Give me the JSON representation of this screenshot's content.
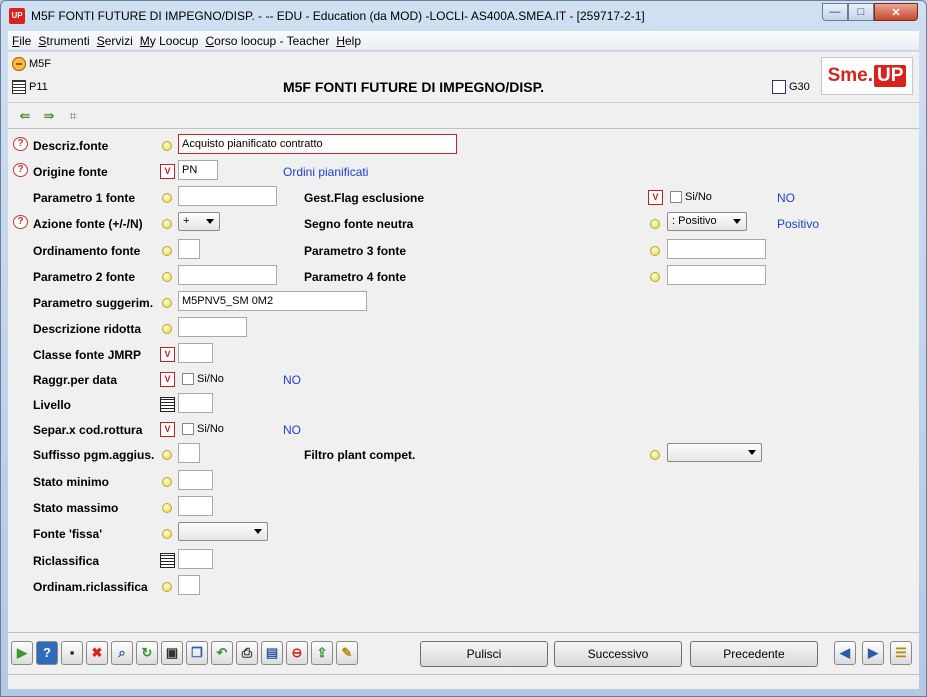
{
  "window": {
    "title": "M5F FONTI FUTURE DI IMPEGNO/DISP. -  -- EDU - Education (da MOD) -LOCLI- AS400A.SMEA.IT - [259717-2-1]",
    "app_icon": "UP",
    "controls": {
      "minimize": "—",
      "maximize": "□",
      "close": "✕"
    }
  },
  "menu": [
    "File",
    "Strumenti",
    "Servizi",
    "My Loocup",
    "Corso loocup - Teacher",
    "Help"
  ],
  "header": {
    "code": "M5F",
    "page": "P11",
    "heading": "M5F FONTI FUTURE DI IMPEGNO/DISP.",
    "g_code": "G30",
    "logo_part1": "Sme.",
    "logo_part2": "UP"
  },
  "form": {
    "descriz_fonte": {
      "label": "Descriz.fonte",
      "value": "Acquisto pianificato contratto"
    },
    "origine_fonte": {
      "label": "Origine fonte",
      "value": "PN",
      "desc": "Ordini pianificati"
    },
    "parametro1": {
      "label": "Parametro 1 fonte",
      "value": ""
    },
    "gest_flag": {
      "label": "Gest.Flag esclusione",
      "check_label": "Si/No",
      "value": "NO"
    },
    "azione_fonte": {
      "label": "Azione fonte (+/-/N)",
      "value": "+"
    },
    "segno_fonte": {
      "label": "Segno fonte neutra",
      "value": ": Positivo",
      "desc": "Positivo"
    },
    "ordinamento": {
      "label": "Ordinamento fonte",
      "value": ""
    },
    "parametro3": {
      "label": "Parametro 3 fonte",
      "value": ""
    },
    "parametro2": {
      "label": "Parametro 2 fonte",
      "value": ""
    },
    "parametro4": {
      "label": "Parametro 4 fonte",
      "value": ""
    },
    "param_sugg": {
      "label": "Parametro suggerim.",
      "value": "M5PNV5_SM 0M2"
    },
    "descr_ridotta": {
      "label": "Descrizione ridotta",
      "value": ""
    },
    "classe_jmrp": {
      "label": "Classe fonte JMRP",
      "value": ""
    },
    "raggr_data": {
      "label": "Raggr.per data",
      "check_label": "Si/No",
      "value": "NO"
    },
    "livello": {
      "label": "Livello",
      "value": ""
    },
    "separ_rottura": {
      "label": "Separ.x cod.rottura",
      "check_label": "Si/No",
      "value": "NO"
    },
    "suffisso": {
      "label": "Suffisso pgm.aggius.",
      "value": ""
    },
    "filtro_plant": {
      "label": "Filtro plant compet.",
      "value": ""
    },
    "stato_minimo": {
      "label": "Stato minimo",
      "value": ""
    },
    "stato_massimo": {
      "label": "Stato massimo",
      "value": ""
    },
    "fonte_fissa": {
      "label": "Fonte 'fissa'",
      "value": ""
    },
    "riclassifica": {
      "label": "Riclassifica",
      "value": ""
    },
    "ordinam_ricl": {
      "label": "Ordinam.riclassifica",
      "value": ""
    }
  },
  "buttons": {
    "pulisci": "Pulisci",
    "successivo": "Successivo",
    "precedente": "Precedente"
  },
  "colors": {
    "accent_red": "#d8231d",
    "link_blue": "#1f3fcc"
  }
}
